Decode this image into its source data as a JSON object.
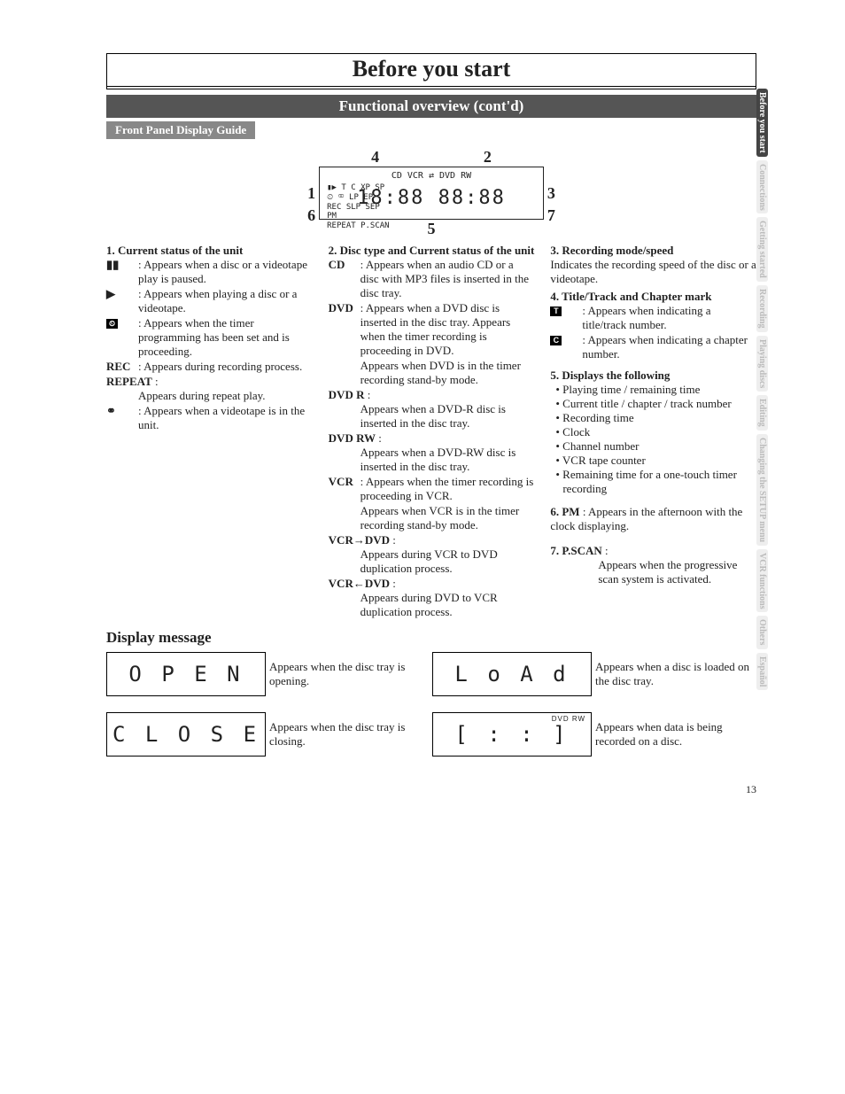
{
  "chapter": {
    "title": "Before you start"
  },
  "sectionBar": "Functional overview (cont'd)",
  "subBar": "Front Panel Display Guide",
  "diagramCallouts": {
    "c1": "1",
    "c2": "2",
    "c3": "3",
    "c4": "4",
    "c5": "5",
    "c6": "6",
    "c7": "7"
  },
  "diagramBox": {
    "line1": "CD      VCR ⇄   DVD   RW",
    "line2": "▮▶        T         C   XP SP",
    "line3": "⏲ ⚭                    LP EP",
    "line4": "REC                     SLP SEP",
    "line5": "PM",
    "line6": "REPEAT                  P.SCAN",
    "seg": "18:88 88:88"
  },
  "col1": {
    "heading": "1.  Current status of the unit",
    "pauseIcon": "▮▮",
    "pauseText": ": Appears when a disc or a videotape play is paused.",
    "playIcon": "▶",
    "playText": ": Appears when playing a disc or a videotape.",
    "timerIcon": "⏲",
    "timerText": ": Appears when the timer programming has been set and is proceeding.",
    "recLabel": "REC",
    "recText": ": Appears during recording process.",
    "repeatLabel": "REPEAT",
    "repeatColon": ":",
    "repeatText": "Appears during repeat play.",
    "tapeIcon": "⚭",
    "tapeText": ": Appears when a videotape is in the unit."
  },
  "col2": {
    "heading": "2.  Disc type and Current status of the unit",
    "cdLabel": "CD",
    "cdText": ": Appears when an audio CD or a disc with MP3 files is inserted in the disc tray.",
    "dvdLabel": "DVD",
    "dvdText": ": Appears when a DVD disc is inserted in the disc tray. Appears when the timer recording is proceeding in DVD.",
    "dvdText2": "Appears when DVD is in the timer recording stand-by mode.",
    "dvdrLabel": "DVD    R",
    "dvdrColon": ":",
    "dvdrText": "Appears when a DVD-R disc is inserted in the disc tray.",
    "dvdrwLabel": "DVD    RW",
    "dvdrwColon": ":",
    "dvdrwText": "Appears when a DVD-RW disc is inserted in the disc tray.",
    "vcrLabel": "VCR",
    "vcrText": ": Appears when the timer recording is proceeding in VCR.",
    "vcrText2": "Appears when VCR is in the timer recording stand-by mode.",
    "vcr2dvdLabel": "VCR→DVD",
    "vcr2dvdColon": ":",
    "vcr2dvdText": "Appears during VCR to DVD duplication process.",
    "dvd2vcrLabel": "VCR←DVD",
    "dvd2vcrColon": ":",
    "dvd2vcrText": "Appears during DVD to VCR duplication process."
  },
  "col3": {
    "heading3": "3.  Recording mode/speed",
    "body3": "Indicates the recording speed of the disc or a videotape.",
    "heading4": "4.  Title/Track and Chapter mark",
    "tLetter": "T",
    "tText": ": Appears when indicating a title/track number.",
    "cLetter": "C",
    "cText": ": Appears when indicating a chapter number.",
    "heading5": "5.  Displays the following",
    "b1": "Playing time / remaining time",
    "b2": "Current title / chapter / track number",
    "b3": "Recording time",
    "b4": "Clock",
    "b5": "Channel number",
    "b6": "VCR tape counter",
    "b7": "Remaining time for a one-touch timer recording",
    "heading6num": "6.",
    "pmLabel": "PM",
    "pmText": ": Appears in the afternoon with the clock displaying.",
    "heading7num": "7.",
    "pscanLabel": "P.SCAN",
    "pscanColon": ":",
    "pscanText": "Appears when the progressive scan system is activated."
  },
  "displayMessageTitle": "Display message",
  "msgs": {
    "m1seg": "O P E N",
    "m1txt": "Appears when the disc tray is opening.",
    "m2seg": "L o A d",
    "m2txt": "Appears when a disc is loaded on the disc tray.",
    "m3seg": "C L O S E",
    "m3txt": "Appears when the disc tray is closing.",
    "m4seg": "[ : : ]",
    "m4flag": "DVD  RW",
    "m4txt": "Appears when data is being recorded on a disc."
  },
  "sideTabs": {
    "t1": "Before you start",
    "t2": "Connections",
    "t3": "Getting started",
    "t4": "Recording",
    "t5": "Playing discs",
    "t6": "Editing",
    "t7": "Changing the SETUP menu",
    "t8": "VCR functions",
    "t9": "Others",
    "t10": "Español"
  },
  "pageNumber": "13"
}
